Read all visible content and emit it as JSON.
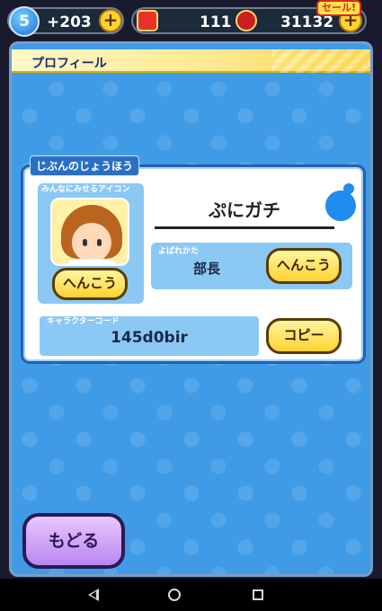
{
  "topbar": {
    "level": "5",
    "stamina": "+203",
    "plus": "+",
    "ykoin": "111",
    "points": "31132",
    "sale_tag": "セール!"
  },
  "screen": {
    "title": "プロフィール"
  },
  "profile": {
    "section_label": "じぶんのじょうほう",
    "icon_label": "みんなにみせるアイコン",
    "change_button_icon": "へんこう",
    "player_name": "ぷにガチ",
    "yobare_label": "よばれかた",
    "yobare_value": "部長",
    "change_button_yobare": "へんこう",
    "code_label": "キャラクターコード",
    "code_value": "145d0bir",
    "copy_button": "コピー"
  },
  "back_button": "もどる",
  "icons": {
    "level_badge": "drop-level-icon",
    "ykoin": "ykoin-icon",
    "points": "points-icon",
    "water_drop": "water-drop-icon",
    "avatar": "player-avatar"
  },
  "colors": {
    "panel": "#3f9be6",
    "button_yellow": "#ffd233",
    "back_button": "#b987f0"
  }
}
